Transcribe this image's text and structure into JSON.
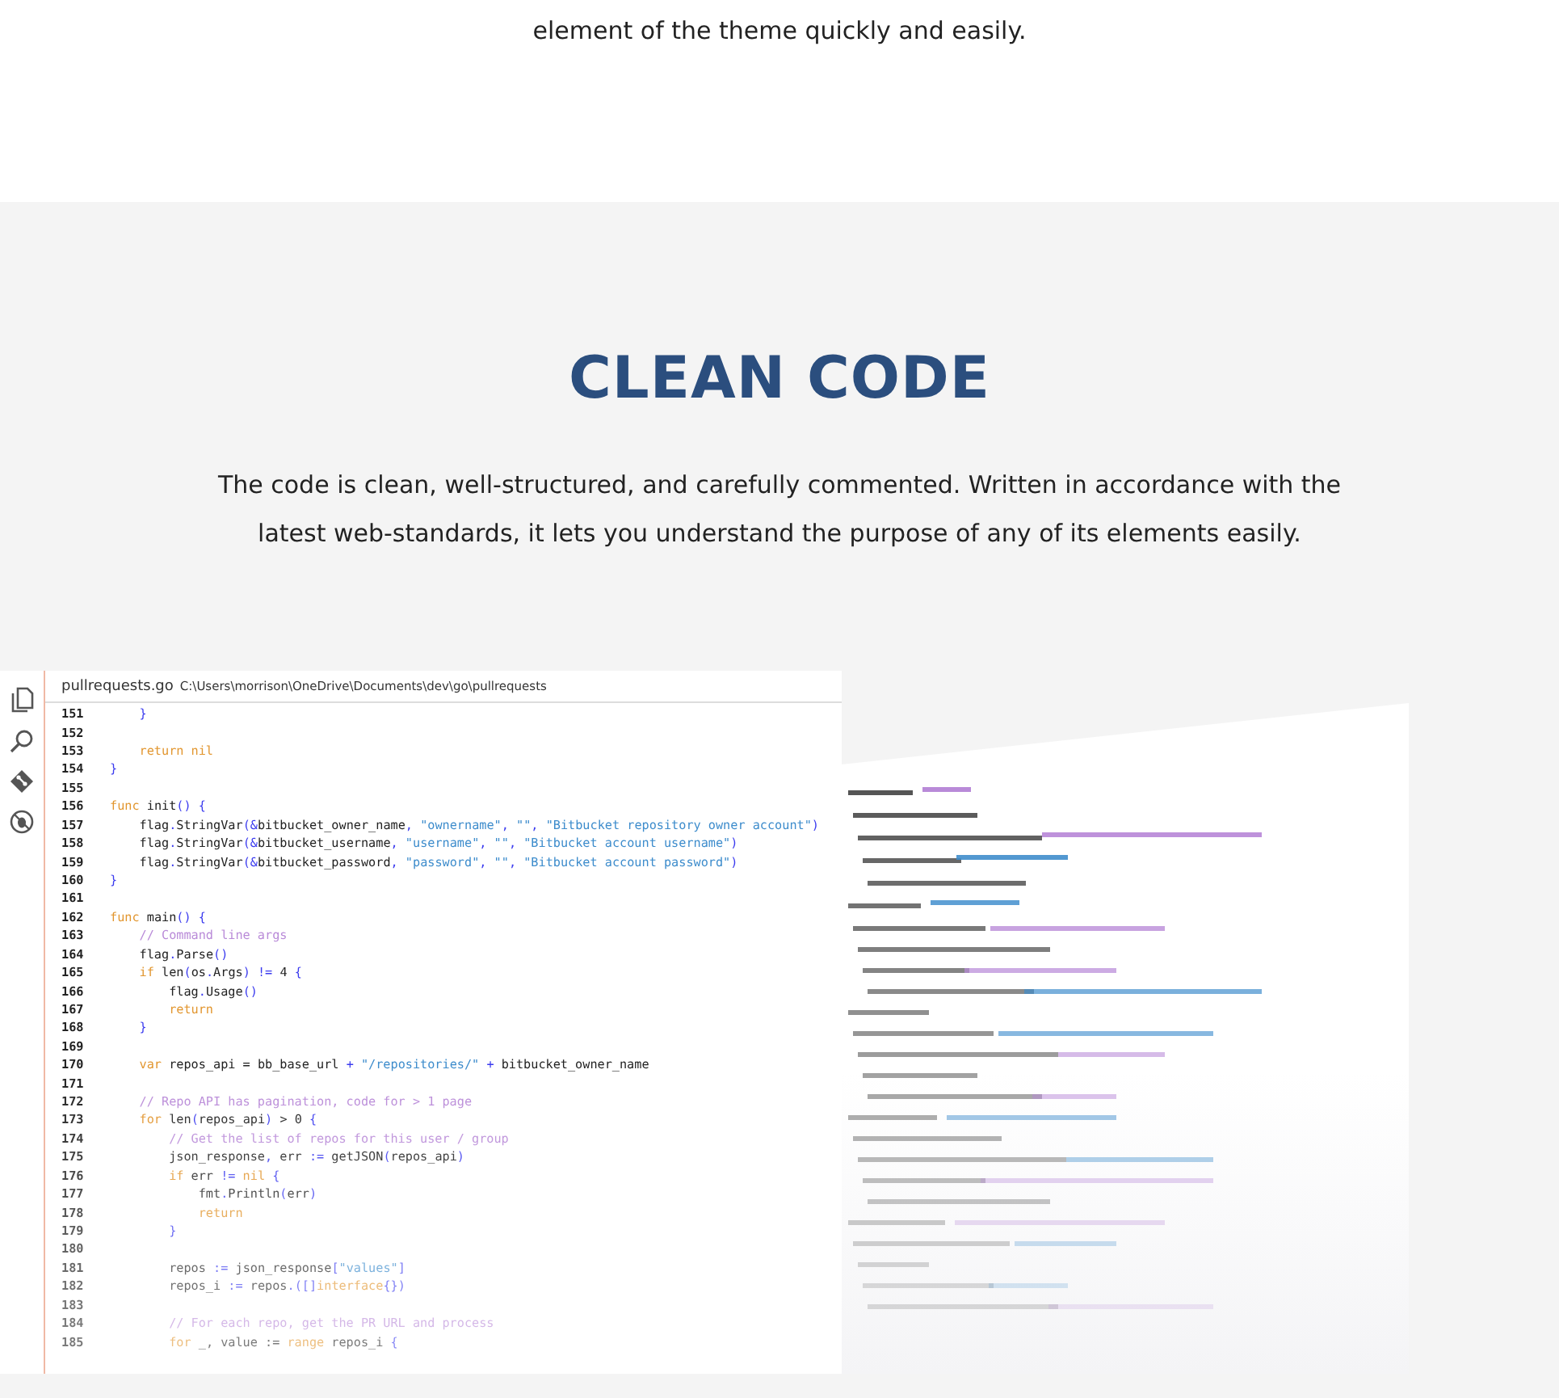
{
  "intro_tail": "element of the theme quickly and easily.",
  "section": {
    "heading": "CLEAN CODE",
    "description": "The code is clean, well-structured, and carefully commented. Written in accordance with the latest web-standards, it lets you understand the purpose of any of its elements easily."
  },
  "editor": {
    "file_name": "pullrequests.go",
    "file_path": "C:\\Users\\morrison\\OneDrive\\Documents\\dev\\go\\pullrequests",
    "lines": [
      {
        "number": "151",
        "tokens": [
          {
            "kind": "punct",
            "text": "    }"
          }
        ]
      },
      {
        "number": "152"
      },
      {
        "number": "153",
        "tokens": [
          {
            "kind": "keyword",
            "text": "    return nil"
          }
        ]
      },
      {
        "number": "154",
        "tokens": [
          {
            "kind": "punct",
            "text": "}"
          }
        ]
      },
      {
        "number": "155"
      },
      {
        "number": "156",
        "tokens": [
          {
            "kind": "keyword",
            "text": "func"
          },
          {
            "kind": "plain",
            "text": " init"
          },
          {
            "kind": "punct",
            "text": "() {"
          }
        ]
      },
      {
        "number": "157",
        "tokens": [
          {
            "kind": "plain",
            "text": "    flag"
          },
          {
            "kind": "punct",
            "text": "."
          },
          {
            "kind": "plain",
            "text": "StringVar"
          },
          {
            "kind": "punct",
            "text": "(&"
          },
          {
            "kind": "plain",
            "text": "bitbucket_owner_name"
          },
          {
            "kind": "punct",
            "text": ", "
          },
          {
            "kind": "string",
            "text": "\"ownername\""
          },
          {
            "kind": "punct",
            "text": ", "
          },
          {
            "kind": "string",
            "text": "\"\""
          },
          {
            "kind": "punct",
            "text": ", "
          },
          {
            "kind": "string",
            "text": "\"Bitbucket repository owner account\""
          },
          {
            "kind": "punct",
            "text": ")"
          }
        ]
      },
      {
        "number": "158",
        "tokens": [
          {
            "kind": "plain",
            "text": "    flag"
          },
          {
            "kind": "punct",
            "text": "."
          },
          {
            "kind": "plain",
            "text": "StringVar"
          },
          {
            "kind": "punct",
            "text": "(&"
          },
          {
            "kind": "plain",
            "text": "bitbucket_username"
          },
          {
            "kind": "punct",
            "text": ", "
          },
          {
            "kind": "string",
            "text": "\"username\""
          },
          {
            "kind": "punct",
            "text": ", "
          },
          {
            "kind": "string",
            "text": "\"\""
          },
          {
            "kind": "punct",
            "text": ", "
          },
          {
            "kind": "string",
            "text": "\"Bitbucket account username\""
          },
          {
            "kind": "punct",
            "text": ")"
          }
        ]
      },
      {
        "number": "159",
        "tokens": [
          {
            "kind": "plain",
            "text": "    flag"
          },
          {
            "kind": "punct",
            "text": "."
          },
          {
            "kind": "plain",
            "text": "StringVar"
          },
          {
            "kind": "punct",
            "text": "(&"
          },
          {
            "kind": "plain",
            "text": "bitbucket_password"
          },
          {
            "kind": "punct",
            "text": ", "
          },
          {
            "kind": "string",
            "text": "\"password\""
          },
          {
            "kind": "punct",
            "text": ", "
          },
          {
            "kind": "string",
            "text": "\"\""
          },
          {
            "kind": "punct",
            "text": ", "
          },
          {
            "kind": "string",
            "text": "\"Bitbucket account password\""
          },
          {
            "kind": "punct",
            "text": ")"
          }
        ]
      },
      {
        "number": "160",
        "tokens": [
          {
            "kind": "punct",
            "text": "}"
          }
        ]
      },
      {
        "number": "161"
      },
      {
        "number": "162",
        "tokens": [
          {
            "kind": "keyword",
            "text": "func"
          },
          {
            "kind": "plain",
            "text": " main"
          },
          {
            "kind": "punct",
            "text": "() {"
          }
        ]
      },
      {
        "number": "163",
        "tokens": [
          {
            "kind": "comment",
            "text": "    // Command line args"
          }
        ]
      },
      {
        "number": "164",
        "tokens": [
          {
            "kind": "plain",
            "text": "    flag"
          },
          {
            "kind": "punct",
            "text": "."
          },
          {
            "kind": "plain",
            "text": "Parse"
          },
          {
            "kind": "punct",
            "text": "()"
          }
        ]
      },
      {
        "number": "165",
        "tokens": [
          {
            "kind": "keyword",
            "text": "    if"
          },
          {
            "kind": "plain",
            "text": " len"
          },
          {
            "kind": "punct",
            "text": "("
          },
          {
            "kind": "plain",
            "text": "os"
          },
          {
            "kind": "punct",
            "text": "."
          },
          {
            "kind": "plain",
            "text": "Args"
          },
          {
            "kind": "punct",
            "text": ") !="
          },
          {
            "kind": "plain",
            "text": " 4 "
          },
          {
            "kind": "punct",
            "text": "{"
          }
        ]
      },
      {
        "number": "166",
        "tokens": [
          {
            "kind": "plain",
            "text": "        flag"
          },
          {
            "kind": "punct",
            "text": "."
          },
          {
            "kind": "plain",
            "text": "Usage"
          },
          {
            "kind": "punct",
            "text": "()"
          }
        ]
      },
      {
        "number": "167",
        "tokens": [
          {
            "kind": "keyword",
            "text": "        return"
          }
        ]
      },
      {
        "number": "168",
        "tokens": [
          {
            "kind": "punct",
            "text": "    }"
          }
        ]
      },
      {
        "number": "169"
      },
      {
        "number": "170",
        "tokens": [
          {
            "kind": "keyword",
            "text": "    var"
          },
          {
            "kind": "plain",
            "text": " repos_api = bb_base_url "
          },
          {
            "kind": "punct",
            "text": "+"
          },
          {
            "kind": "string",
            "text": " \"/repositories/\" "
          },
          {
            "kind": "punct",
            "text": "+"
          },
          {
            "kind": "plain",
            "text": " bitbucket_owner_name"
          }
        ]
      },
      {
        "number": "171"
      },
      {
        "number": "172",
        "tokens": [
          {
            "kind": "comment",
            "text": "    // Repo API has pagination, code for > 1 page"
          }
        ]
      },
      {
        "number": "173",
        "tokens": [
          {
            "kind": "keyword",
            "text": "    for"
          },
          {
            "kind": "plain",
            "text": " len"
          },
          {
            "kind": "punct",
            "text": "("
          },
          {
            "kind": "plain",
            "text": "repos_api"
          },
          {
            "kind": "punct",
            "text": ")"
          },
          {
            "kind": "plain",
            "text": " > 0 "
          },
          {
            "kind": "punct",
            "text": "{"
          }
        ]
      },
      {
        "number": "174",
        "tokens": [
          {
            "kind": "comment",
            "text": "        // Get the list of repos for this user / group"
          }
        ]
      },
      {
        "number": "175",
        "tokens": [
          {
            "kind": "plain",
            "text": "        json_response"
          },
          {
            "kind": "punct",
            "text": ","
          },
          {
            "kind": "plain",
            "text": " err "
          },
          {
            "kind": "punct",
            "text": ":="
          },
          {
            "kind": "plain",
            "text": " getJSON"
          },
          {
            "kind": "punct",
            "text": "("
          },
          {
            "kind": "plain",
            "text": "repos_api"
          },
          {
            "kind": "punct",
            "text": ")"
          }
        ]
      },
      {
        "number": "176",
        "tokens": [
          {
            "kind": "keyword",
            "text": "        if"
          },
          {
            "kind": "plain",
            "text": " err "
          },
          {
            "kind": "punct",
            "text": "!="
          },
          {
            "kind": "keyword",
            "text": " nil "
          },
          {
            "kind": "punct",
            "text": "{"
          }
        ]
      },
      {
        "number": "177",
        "tokens": [
          {
            "kind": "plain",
            "text": "            fmt"
          },
          {
            "kind": "punct",
            "text": "."
          },
          {
            "kind": "plain",
            "text": "Println"
          },
          {
            "kind": "punct",
            "text": "("
          },
          {
            "kind": "plain",
            "text": "err"
          },
          {
            "kind": "punct",
            "text": ")"
          }
        ]
      },
      {
        "number": "178",
        "tokens": [
          {
            "kind": "keyword",
            "text": "            return"
          }
        ]
      },
      {
        "number": "179",
        "tokens": [
          {
            "kind": "punct",
            "text": "        }"
          }
        ]
      },
      {
        "number": "180"
      },
      {
        "number": "181",
        "tokens": [
          {
            "kind": "plain",
            "text": "        repos "
          },
          {
            "kind": "punct",
            "text": ":="
          },
          {
            "kind": "plain",
            "text": " json_response"
          },
          {
            "kind": "punct",
            "text": "["
          },
          {
            "kind": "string",
            "text": "\"values\""
          },
          {
            "kind": "punct",
            "text": "]"
          }
        ]
      },
      {
        "number": "182",
        "tokens": [
          {
            "kind": "plain",
            "text": "        repos_i "
          },
          {
            "kind": "punct",
            "text": ":="
          },
          {
            "kind": "plain",
            "text": " repos"
          },
          {
            "kind": "punct",
            "text": ".([]"
          },
          {
            "kind": "keyword",
            "text": "interface"
          },
          {
            "kind": "punct",
            "text": "{})"
          }
        ]
      },
      {
        "number": "183"
      },
      {
        "number": "184",
        "tokens": [
          {
            "kind": "comment",
            "text": "        // For each repo, get the PR URL and process"
          }
        ]
      },
      {
        "number": "185",
        "tokens": [
          {
            "kind": "keyword",
            "text": "        for"
          },
          {
            "kind": "plain",
            "text": " _, value := "
          },
          {
            "kind": "keyword",
            "text": "range"
          },
          {
            "kind": "plain",
            "text": " repos_i "
          },
          {
            "kind": "punct",
            "text": "{"
          }
        ]
      }
    ]
  }
}
